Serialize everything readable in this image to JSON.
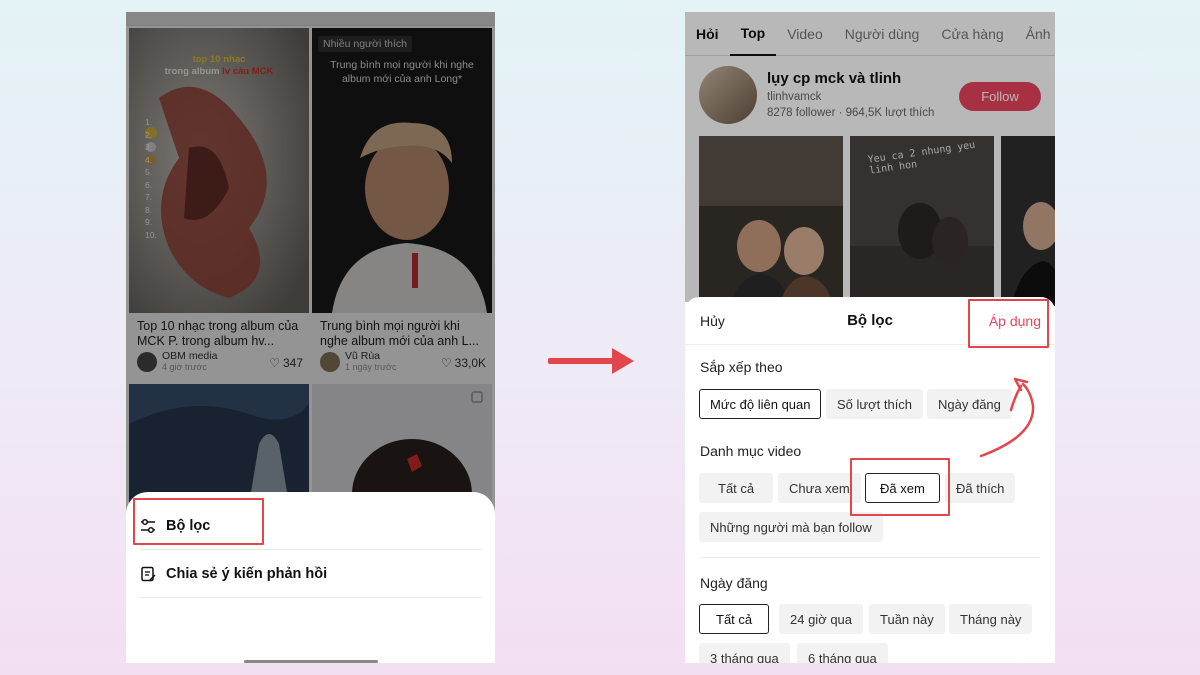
{
  "left_screen": {
    "cards": [
      {
        "overlay_title_line1": "top 10 nhạc",
        "overlay_title_line2": "trong album",
        "overlay_title_highlight": "lv cảu MCK",
        "rank_numbers": [
          "1.",
          "2.",
          "3.",
          "4.",
          "5.",
          "6.",
          "7.",
          "8.",
          "9.",
          "10."
        ],
        "caption": "Top 10 nhạc trong album của MCK P. trong album hv...",
        "author": "OBM media",
        "time": "4 giờ trước",
        "likes": "347"
      },
      {
        "badge": "Nhiều người thích",
        "overlay_text": "Trung bình mọi người khi nghe album mới của anh Long*",
        "caption": "Trung bình mọi người khi nghe album mới của anh L...",
        "author": "Vũ Rùa",
        "time": "1 ngày trước",
        "likes": "33,0K"
      }
    ],
    "sheet": {
      "filter_label": "Bộ lọc",
      "feedback_label": "Chia sẻ ý kiến phản hồi"
    }
  },
  "right_screen": {
    "tabs": [
      {
        "label": "Hỏi"
      },
      {
        "label": "Top"
      },
      {
        "label": "Video"
      },
      {
        "label": "Người dùng"
      },
      {
        "label": "Cửa hàng"
      },
      {
        "label": "Ảnh"
      }
    ],
    "profile": {
      "name": "lụy cp mck và tlinh",
      "handle": "tlinhvamck",
      "stats": "8278 follower · 964,5K lượt thích",
      "follow_label": "Follow"
    },
    "thumb_overlay_text": "Yeu ca 2 nhung yeu linh hon",
    "filter_sheet": {
      "cancel_label": "Hủy",
      "title": "Bộ lọc",
      "apply_label": "Áp dụng",
      "sort_section": {
        "title": "Sắp xếp theo",
        "options": [
          "Mức độ liên quan",
          "Số lượt thích",
          "Ngày đăng"
        ]
      },
      "category_section": {
        "title": "Danh mục video",
        "options": [
          "Tất cả",
          "Chưa xem",
          "Đã xem",
          "Đã thích",
          "Những người mà bạn follow"
        ]
      },
      "date_section": {
        "title": "Ngày đăng",
        "options": [
          "Tất cả",
          "24 giờ qua",
          "Tuần này",
          "Tháng này",
          "3 tháng qua",
          "6 tháng qua"
        ]
      }
    }
  },
  "colors": {
    "accent_red": "#e8455c",
    "highlight_red": "#e0464c"
  }
}
